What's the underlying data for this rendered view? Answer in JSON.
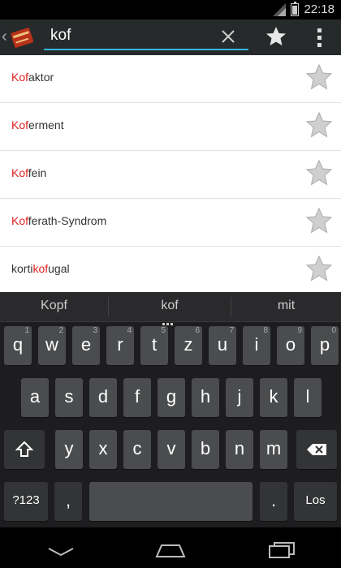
{
  "status_bar": {
    "time": "22:18"
  },
  "search": {
    "query": "kof"
  },
  "results": [
    {
      "pre": "",
      "hl": "Kof",
      "post": "aktor"
    },
    {
      "pre": "",
      "hl": "Kof",
      "post": "erment"
    },
    {
      "pre": "",
      "hl": "Kof",
      "post": "fein"
    },
    {
      "pre": "",
      "hl": "Kof",
      "post": "ferath-Syndrom"
    },
    {
      "pre": "korti",
      "hl": "kof",
      "post": "ugal"
    }
  ],
  "keyboard": {
    "suggestions": [
      "Kopf",
      "kof",
      "mit"
    ],
    "row1": [
      {
        "label": "q",
        "hint": "1"
      },
      {
        "label": "w",
        "hint": "2"
      },
      {
        "label": "e",
        "hint": "3"
      },
      {
        "label": "r",
        "hint": "4"
      },
      {
        "label": "t",
        "hint": "5"
      },
      {
        "label": "z",
        "hint": "6"
      },
      {
        "label": "u",
        "hint": "7"
      },
      {
        "label": "i",
        "hint": "8"
      },
      {
        "label": "o",
        "hint": "9"
      },
      {
        "label": "p",
        "hint": "0"
      }
    ],
    "row2": [
      "a",
      "s",
      "d",
      "f",
      "g",
      "h",
      "j",
      "k",
      "l"
    ],
    "row3": [
      "y",
      "x",
      "c",
      "v",
      "b",
      "n",
      "m"
    ],
    "symbols_label": "?123",
    "comma_label": ",",
    "period_label": ".",
    "enter_label": "Los"
  },
  "colors": {
    "highlight": "#e02020",
    "accent": "#33b5e5"
  }
}
